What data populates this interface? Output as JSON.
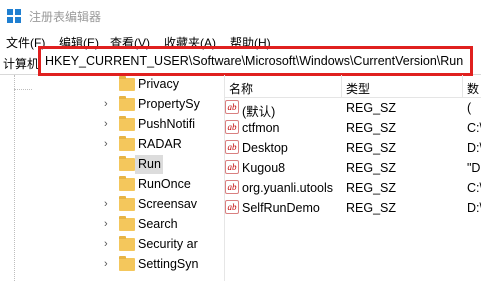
{
  "window": {
    "title": "注册表编辑器"
  },
  "menu": [
    "文件(F)",
    "编辑(E)",
    "查看(V)",
    "收藏夹(A)",
    "帮助(H)"
  ],
  "address": {
    "root": "计算机",
    "path": "HKEY_CURRENT_USER\\Software\\Microsoft\\Windows\\CurrentVersion\\Run"
  },
  "tree": {
    "items": [
      {
        "label": "Privacy",
        "expandable": false,
        "selected": false
      },
      {
        "label": "PropertySy",
        "expandable": true,
        "selected": false
      },
      {
        "label": "PushNotifi",
        "expandable": true,
        "selected": false
      },
      {
        "label": "RADAR",
        "expandable": true,
        "selected": false
      },
      {
        "label": "Run",
        "expandable": false,
        "selected": true
      },
      {
        "label": "RunOnce",
        "expandable": false,
        "selected": false
      },
      {
        "label": "Screensav",
        "expandable": true,
        "selected": false
      },
      {
        "label": "Search",
        "expandable": true,
        "selected": false
      },
      {
        "label": "Security ar",
        "expandable": true,
        "selected": false
      },
      {
        "label": "SettingSyn",
        "expandable": true,
        "selected": false
      }
    ]
  },
  "list": {
    "columns": [
      "名称",
      "类型",
      "数"
    ],
    "rows": [
      {
        "name": "(默认)",
        "type": "REG_SZ",
        "data": "("
      },
      {
        "name": "ctfmon",
        "type": "REG_SZ",
        "data": "C:\\"
      },
      {
        "name": "Desktop",
        "type": "REG_SZ",
        "data": "D:\\"
      },
      {
        "name": "Kugou8",
        "type": "REG_SZ",
        "data": "\"D"
      },
      {
        "name": "org.yuanli.utools",
        "type": "REG_SZ",
        "data": "C:\\"
      },
      {
        "name": "SelfRunDemo",
        "type": "REG_SZ",
        "data": "D:\\"
      }
    ]
  },
  "icons": {
    "app": "registry-editor-icon",
    "folder": "folder-icon",
    "chevron": "chevron-right-icon",
    "value": "string-value-icon",
    "value_glyph": "ab"
  },
  "colors": {
    "highlight_border": "#e0201f",
    "folder": "#f4c75c",
    "selected_bg": "#dcdcdc"
  }
}
